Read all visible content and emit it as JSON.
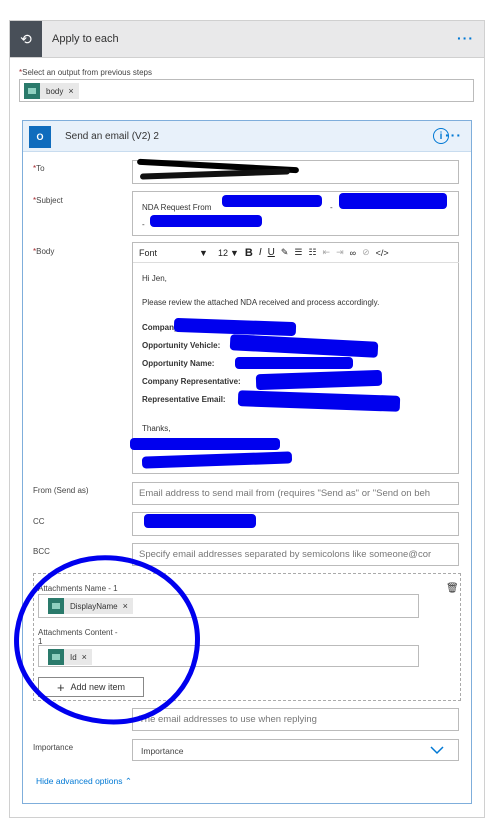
{
  "loop": {
    "title": "Apply to each",
    "more_label": "···",
    "select_label": "Select an output from previous steps",
    "required_mark": "*",
    "token": {
      "label": "body",
      "remove": "×"
    }
  },
  "action": {
    "title": "Send an email (V2) 2",
    "info_label": "i",
    "more_label": "···",
    "icon": "outlook-icon"
  },
  "fields": {
    "to_label": "To",
    "subject_label": "Subject",
    "subject_text": "NDA Request From",
    "subject_sep1": "-",
    "subject_sep2": "-",
    "body_label": "Body",
    "from_label": "From (Send as)",
    "from_placeholder": "Email address to send mail from (requires \"Send as\" or \"Send on beh",
    "cc_label": "CC",
    "bcc_label": "BCC",
    "bcc_placeholder": "Specify email addresses separated by semicolons like someone@cor",
    "reply_placeholder": "The email addresses to use when replying",
    "importance_label": "Importance",
    "importance_value": "Importance"
  },
  "editor": {
    "font": "Font",
    "size": "12",
    "bold": "B",
    "italic": "I",
    "underline": "U"
  },
  "body": {
    "greeting": "Hi Jen,",
    "line1": "Please review the attached NDA received and process accordingly.",
    "company": "Company",
    "vehicle": "Opportunity Vehicle:",
    "opp_name": "Opportunity Name:",
    "rep": "Company Representative:",
    "rep_email": "Representative Email:",
    "thanks": "Thanks,"
  },
  "attachments": {
    "name_label": "Attachments Name - 1",
    "name_token": "DisplayName",
    "content_label": "Attachments Content -",
    "content_label2": "1",
    "content_token": "Id",
    "remove": "×",
    "add_label": "Add new item"
  },
  "footer": {
    "advanced_label": "Hide advanced options"
  }
}
